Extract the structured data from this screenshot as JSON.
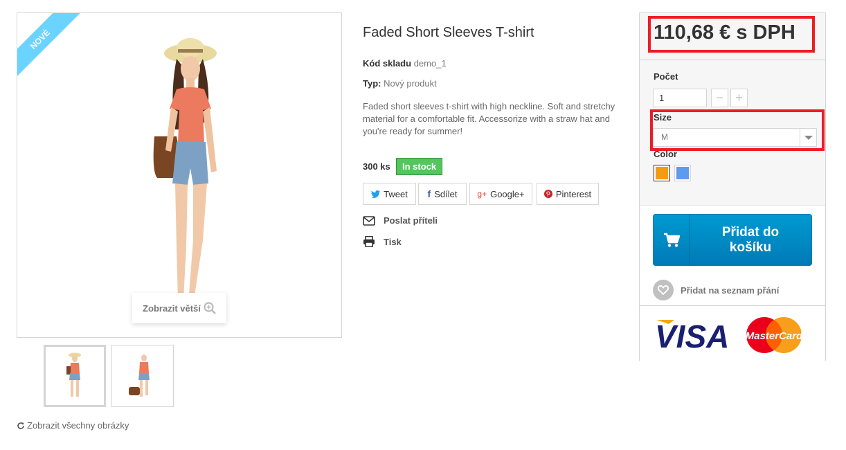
{
  "product": {
    "badge": "Nové",
    "title": "Faded Short Sleeves T-shirt",
    "sku_label": "Kód skladu",
    "sku_value": "demo_1",
    "condition_label": "Typ:",
    "condition_value": "Nový produkt",
    "description": "Faded short sleeves t-shirt with high neckline. Soft and stretchy material for a comfortable fit. Accessorize with a straw hat and you're ready for summer!",
    "quantity": "300 ks",
    "stock_status": "In stock"
  },
  "gallery": {
    "zoom_label": "Zobrazit větší",
    "view_all_label": "Zobrazit všechny obrázky"
  },
  "social": {
    "tweet": "Tweet",
    "share": "Sdílet",
    "google": "Google+",
    "pinterest": "Pinterest"
  },
  "actions": {
    "send_friend": "Poslat příteli",
    "print": "Tisk"
  },
  "buy_box": {
    "price": "110,68 € s DPH",
    "quantity_label": "Počet",
    "quantity_value": "1",
    "minus": "−",
    "plus": "+",
    "size_label": "Size",
    "size_selected": "M",
    "color_label": "Color",
    "colors": [
      "#f39c11",
      "#5d9cec"
    ],
    "add_to_cart": "Přidat do košíku",
    "wishlist": "Přidat na seznam přání",
    "payment_visa": "VISA",
    "payment_mastercard": "MasterCard"
  },
  "theme": {
    "accent_blue": "#009ad0",
    "stock_green": "#55c65e",
    "highlight_red": "#ee1c25",
    "ribbon_blue": "#6ad4ff"
  }
}
